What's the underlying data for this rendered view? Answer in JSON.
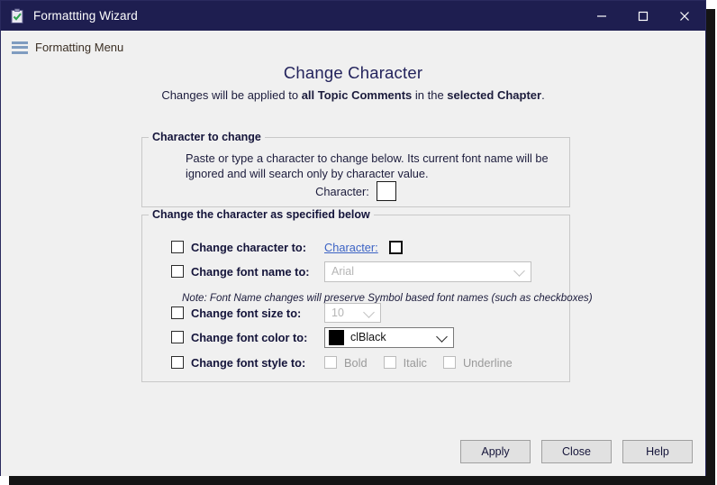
{
  "window": {
    "title": "Formattting Wizard",
    "icon": "clipboard-check-icon",
    "titlebar_color": "#1e1e50",
    "minimize_label": "−",
    "maximize_label": "□",
    "close_label": "✕"
  },
  "menu": {
    "icon": "hamburger-icon",
    "label": "Formatting Menu"
  },
  "header": {
    "title": "Change Character",
    "subtitle_pre": "Changes will be applied to ",
    "subtitle_bold1": "all Topic Comments",
    "subtitle_mid": " in the ",
    "subtitle_bold2": "selected Chapter",
    "subtitle_post": "."
  },
  "group_character": {
    "title": "Character to change",
    "description": "Paste or type a character to change below.  Its current font name will be ignored and will search only by character value.",
    "character_label": "Character:",
    "character_value": ""
  },
  "group_change": {
    "title": "Change the character as specified below",
    "rows": {
      "character": {
        "checkbox_label": "Change character to:",
        "checked": false,
        "link_label": "Character:",
        "value": ""
      },
      "font_name": {
        "checkbox_label": "Change font name to:",
        "checked": false,
        "enabled": false,
        "value": "Arial"
      },
      "note": "Note: Font Name changes will preserve Symbol based font names (such as checkboxes)",
      "font_size": {
        "checkbox_label": "Change font size to:",
        "checked": false,
        "enabled": false,
        "value": "10"
      },
      "font_color": {
        "checkbox_label": "Change font color to:",
        "checked": false,
        "enabled": true,
        "value": "clBlack",
        "swatch": "#000000"
      },
      "font_style": {
        "checkbox_label": "Change font style to:",
        "checked": false,
        "bold_label": "Bold",
        "italic_label": "Italic",
        "underline_label": "Underline",
        "bold_checked": false,
        "italic_checked": false,
        "underline_checked": false,
        "enabled": false
      }
    }
  },
  "footer": {
    "apply_label": "Apply",
    "close_label": "Close",
    "help_label": "Help"
  }
}
